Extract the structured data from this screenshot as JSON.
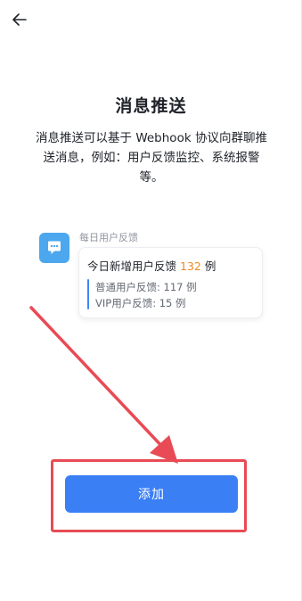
{
  "header": {
    "back_icon": "arrow-left-icon"
  },
  "page": {
    "title": "消息推送",
    "description": "消息推送可以基于 Webhook 协议向群聊推送消息，例如：用户反馈监控、系统报警等。"
  },
  "preview": {
    "bot_name": "每日用户反馈",
    "avatar_icon": "chat-bubble-icon",
    "avatar_color": "#4ca7ee",
    "message": {
      "prefix": "今日新增用户反馈",
      "count": "132",
      "suffix": "例",
      "count_color": "#f08a24",
      "lines": [
        "普通用户反馈: 117 例",
        "VIP用户反馈: 15 例"
      ]
    }
  },
  "actions": {
    "add_label": "添加",
    "button_color": "#3b7ff5"
  },
  "annotation": {
    "highlight_color": "#e84b55"
  }
}
